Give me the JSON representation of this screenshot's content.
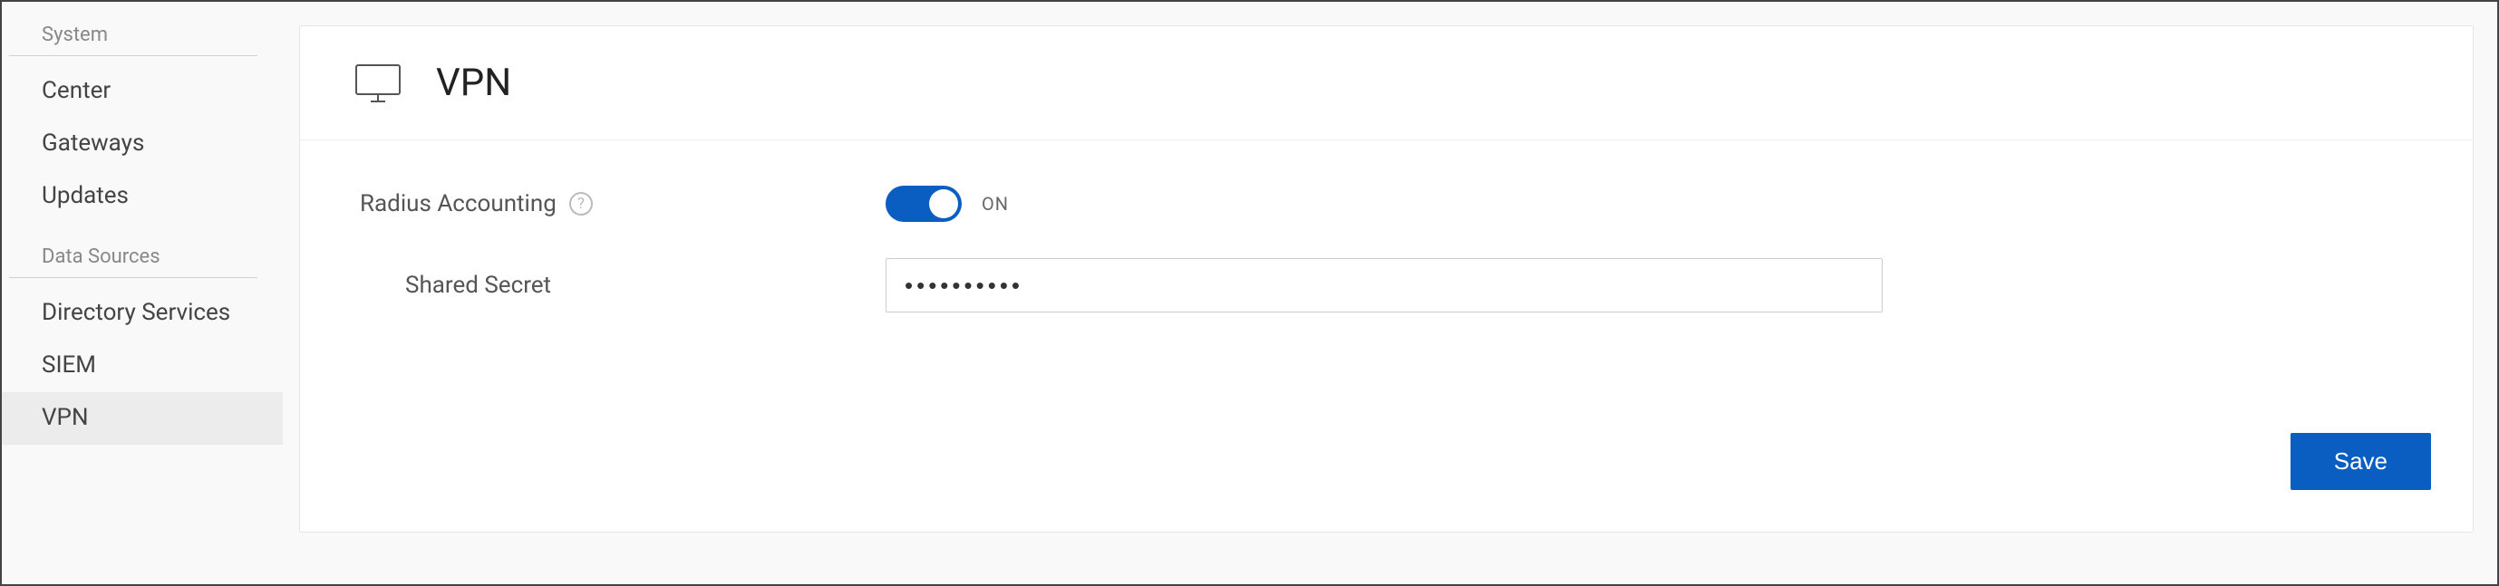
{
  "sidebar": {
    "sections": [
      {
        "title": "System",
        "items": [
          {
            "label": "Center",
            "active": false
          },
          {
            "label": "Gateways",
            "active": false
          },
          {
            "label": "Updates",
            "active": false
          }
        ]
      },
      {
        "title": "Data Sources",
        "items": [
          {
            "label": "Directory Services",
            "active": false
          },
          {
            "label": "SIEM",
            "active": false
          },
          {
            "label": "VPN",
            "active": true
          }
        ]
      }
    ]
  },
  "page": {
    "title": "VPN",
    "icon": "monitor-icon"
  },
  "form": {
    "radius_accounting": {
      "label": "Radius Accounting",
      "state": "ON",
      "on": true
    },
    "shared_secret": {
      "label": "Shared Secret",
      "value": "••••••••••"
    }
  },
  "actions": {
    "save_label": "Save"
  },
  "help_glyph": "?",
  "colors": {
    "accent": "#0a5ec2"
  }
}
